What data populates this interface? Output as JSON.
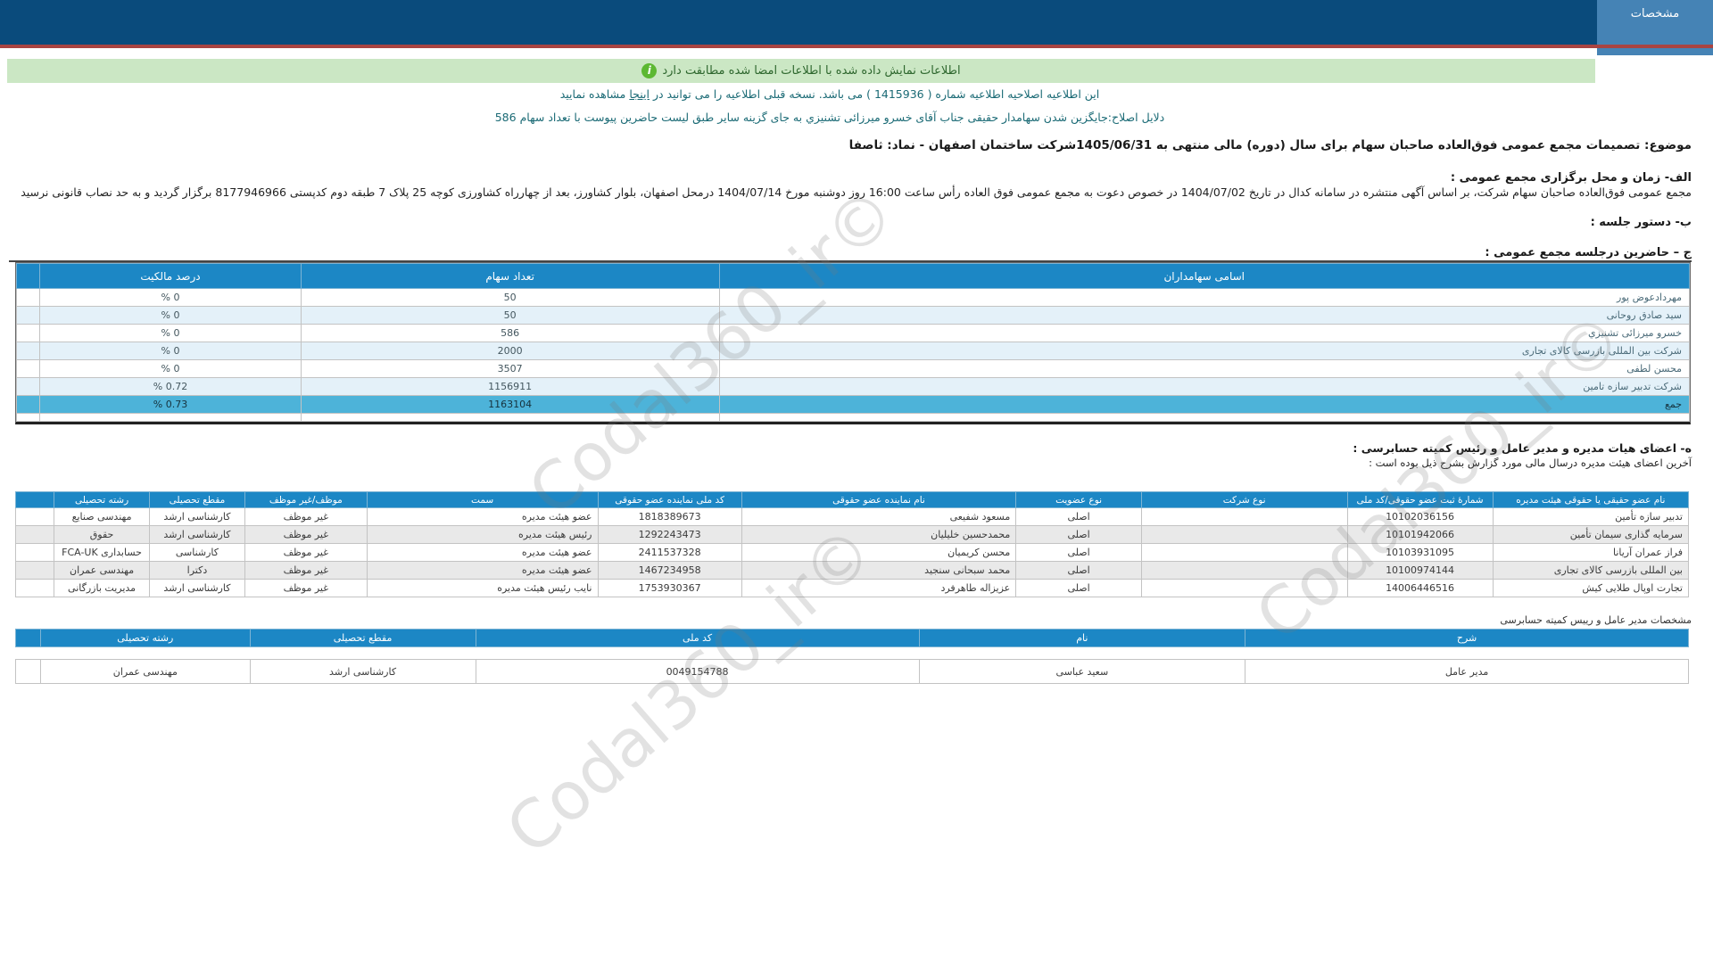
{
  "header": {
    "tab_label": "مشخصات"
  },
  "alerts": {
    "signed_info": "اطلاعات نمایش داده شده با اطلاعات امضا شده مطابقت دارد",
    "revision_before": "این اطلاعیه اصلاحیه اطلاعیه شماره ( 1415936 ) می باشد. نسخه قبلی اطلاعیه را می توانید در ",
    "revision_link": "اینجا",
    "revision_after": " مشاهده نمایید",
    "revision_reason": "دلایل اصلاح:جایگزین شدن سهامدار حقیقی جناب آقای خسرو میرزائی تشنیزي به جای گزینه سایر طبق لیست حاضرین پیوست با تعداد سهام 586"
  },
  "subject": "موضوع: تصمیمات مجمع عمومی فوق‌العاده صاحبان سهام برای سال (دوره) مالی منتهی به 1405/06/31شرکت ساختمان اصفهان - نماد: ثاصفا",
  "sections": {
    "a_title": "الف- زمان و محل برگزاری مجمع عمومی :",
    "a_body": "مجمع عمومی فوق‌العاده صاحبان سهام شرکت، بر اساس آگهی منتشره در سامانه کدال در تاریخ 1404/07/02 در خصوص دعوت به مجمع عمومی فوق العاده رأس ساعت 16:00 روز دوشنبه مورخ 1404/07/14 درمحل اصفهان، بلوار کشاورز، بعد از چهارراه کشاورزی کوچه 25 پلاک 7 طبقه دوم کدپستی 8177946966  برگزار گردید و به حد نصاب قانونی نرسید",
    "b_title": "ب- دستور جلسه :",
    "c_title": "ج – حاضرین درجلسه مجمع عمومی :",
    "e_title": "ه- اعضای هیات مدیره و مدیر عامل و رئیس کمیته حسابرسی :",
    "e_subtitle": "آخرین اعضای هیئت مدیره درسال مالی مورد گزارش بشرح ذیل بوده است :",
    "ceo_title": "مشخصات مدیر عامل و رییس کمیته حسابرسی"
  },
  "attendees": {
    "headers": [
      "اسامی سهامداران",
      "تعداد سهام",
      "درصد مالکیت"
    ],
    "rows": [
      {
        "name": "مهردادعوض پور",
        "shares": "50",
        "pct": "% 0"
      },
      {
        "name": "سید صادق روحانی",
        "shares": "50",
        "pct": "% 0"
      },
      {
        "name": "خسرو میرزائی تشنیزي",
        "shares": "586",
        "pct": "% 0"
      },
      {
        "name": "شرکت بین المللی بازرسی کالای تجاری",
        "shares": "2000",
        "pct": "% 0"
      },
      {
        "name": "محسن لطفی",
        "shares": "3507",
        "pct": "% 0"
      },
      {
        "name": "شرکت تدبیر سازه تامین",
        "shares": "1156911",
        "pct": "% 0.72"
      }
    ],
    "total": {
      "name": "جمع",
      "shares": "1163104",
      "pct": "% 0.73"
    }
  },
  "board": {
    "headers": [
      "نام عضو حقیقی یا حقوقی هیئت مدیره",
      "شمارهٔ ثبت عضو حقوقی/کد ملی",
      "نوع شرکت",
      "نوع عضویت",
      "نام نماینده عضو حقوقی",
      "کد ملی نماینده عضو حقوقی",
      "سمت",
      "موظف/غیر موظف",
      "مقطع تحصیلی",
      "رشته تحصیلی"
    ],
    "rows": [
      [
        "تدبیر سازه تأمین",
        "10102036156",
        "",
        "اصلی",
        "مسعود شفیعی",
        "1818389673",
        "عضو هیئت مدیره",
        "غیر موظف",
        "کارشناسی ارشد",
        "مهندسی صنایع"
      ],
      [
        "سرمایه گذاری سیمان تأمین",
        "10101942066",
        "",
        "اصلی",
        "محمدحسین خلیلیان",
        "1292243473",
        "رئیس هیئت مدیره",
        "غیر موظف",
        "کارشناسی ارشد",
        "حقوق"
      ],
      [
        "فراز عمران آریانا",
        "10103931095",
        "",
        "اصلی",
        "محسن کریمیان",
        "2411537328",
        "عضو هیئت مدیره",
        "غیر موظف",
        "کارشناسی",
        "حسابداری FCA-UK"
      ],
      [
        "بین المللی بازرسی کالای تجاری",
        "10100974144",
        "",
        "اصلی",
        "محمد سبحانی سنجید",
        "1467234958",
        "عضو هیئت مدیره",
        "غیر موظف",
        "دکترا",
        "مهندسی عمران"
      ],
      [
        "تجارت اوپال طلایی کیش",
        "14006446516",
        "",
        "اصلی",
        "عزیزاله طاهرفرد",
        "1753930367",
        "نایب رئیس هیئت مدیره",
        "غیر موظف",
        "کارشناسی ارشد",
        "مدیریت بازرگانی"
      ]
    ]
  },
  "ceo": {
    "headers": [
      "شرح",
      "نام",
      "کد ملی",
      "مقطع تحصیلی",
      "رشته تحصیلی"
    ],
    "row": [
      "مدیر عامل",
      "سعید عباسی",
      "0049154788",
      "کارشناسی ارشد",
      "مهندسی عمران"
    ]
  },
  "watermark": "©Codal360_ir",
  "colors": {
    "header_navy": "#0a4b7c",
    "tab_blue": "#4583b5",
    "accent_red": "#a94442",
    "success_bg": "#cbe7c4",
    "success_icon_green": "#5cb832",
    "table_header_blue": "#1c87c5",
    "total_row_blue": "#4db3d9",
    "notice_teal": "#1a6a75"
  }
}
